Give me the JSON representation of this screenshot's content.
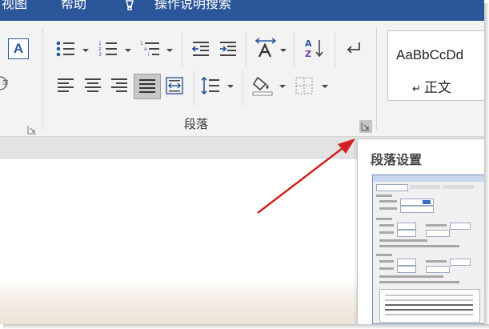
{
  "menu": {
    "items": [
      "视图",
      "帮助",
      "操作说明搜索"
    ]
  },
  "ribbon": {
    "font_group_label": "",
    "paragraph_group_label": "段落",
    "styles": {
      "sample_text": "AaBbCcDd",
      "style_name": "正文",
      "paragraph_mark": "↵"
    }
  },
  "tooltip": {
    "title": "段落设置"
  },
  "colors": {
    "title_bar": "#2b579a",
    "ribbon_bg": "#f3f3f3",
    "arrow": "#d32020",
    "justify_active": "#c8c8c8"
  }
}
